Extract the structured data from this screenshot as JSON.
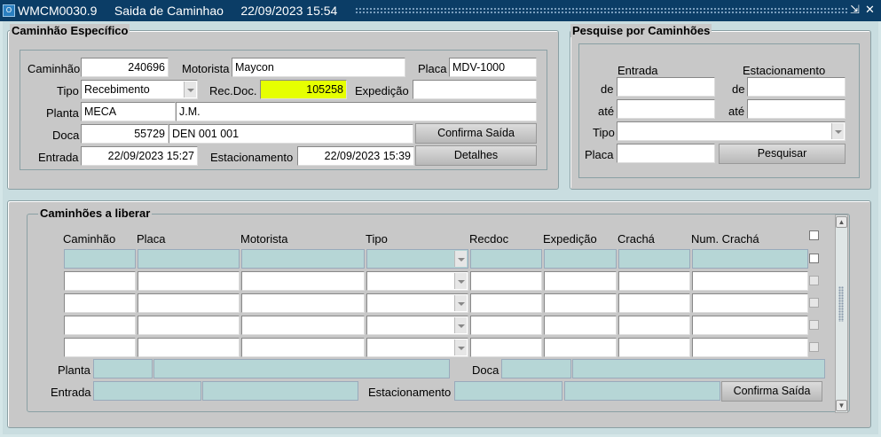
{
  "window": {
    "title": "WMCM0030.9     Saida de Caminhao     22/09/2023 15:54",
    "icon_label": "O",
    "min_glyph": "⇲",
    "close_glyph": "✕"
  },
  "caminhao_especifico": {
    "title": "Caminhão Específico",
    "caminhao_label": "Caminhão",
    "caminhao": "240696",
    "motorista_label": "Motorista",
    "motorista": "Maycon",
    "placa_label": "Placa",
    "placa": "MDV-1000",
    "tipo_label": "Tipo",
    "tipo": "Recebimento",
    "recdoc_label": "Rec.Doc.",
    "recdoc": "105258",
    "expedicao_label": "Expedição",
    "expedicao": "",
    "planta_label": "Planta",
    "planta_code": "MECA",
    "planta_name": "J.M.",
    "doca_label": "Doca",
    "doca_code": "55729",
    "doca_name": "DEN 001 001",
    "entrada_label": "Entrada",
    "entrada": "22/09/2023 15:27",
    "estacionamento_label": "Estacionamento",
    "estacionamento": "22/09/2023 15:39",
    "confirma_label": "Confirma Saída",
    "detalhes_label": "Detalhes"
  },
  "pesquise": {
    "title": "Pesquise por Caminhões",
    "entrada_header": "Entrada",
    "estacionamento_header": "Estacionamento",
    "de_label": "de",
    "ate_label": "até",
    "de2_label": "de",
    "ate2_label": "até",
    "tipo_label": "Tipo",
    "placa_label": "Placa",
    "pesquisar_label": "Pesquisar"
  },
  "liberar": {
    "title": "Caminhões a liberar",
    "columns": [
      "Caminhão",
      "Placa",
      "Motorista",
      "Tipo",
      "Recdoc",
      "Expedição",
      "Crachá",
      "Num. Crachá"
    ],
    "planta_label": "Planta",
    "doca_label": "Doca",
    "entrada_label": "Entrada",
    "estacionamento_label": "Estacionamento",
    "confirma_label": "Confirma Saída"
  },
  "colors": {
    "titlebar": "#0b3d66",
    "highlight": "#e6ff00",
    "current_row": "#b6d6d6"
  }
}
